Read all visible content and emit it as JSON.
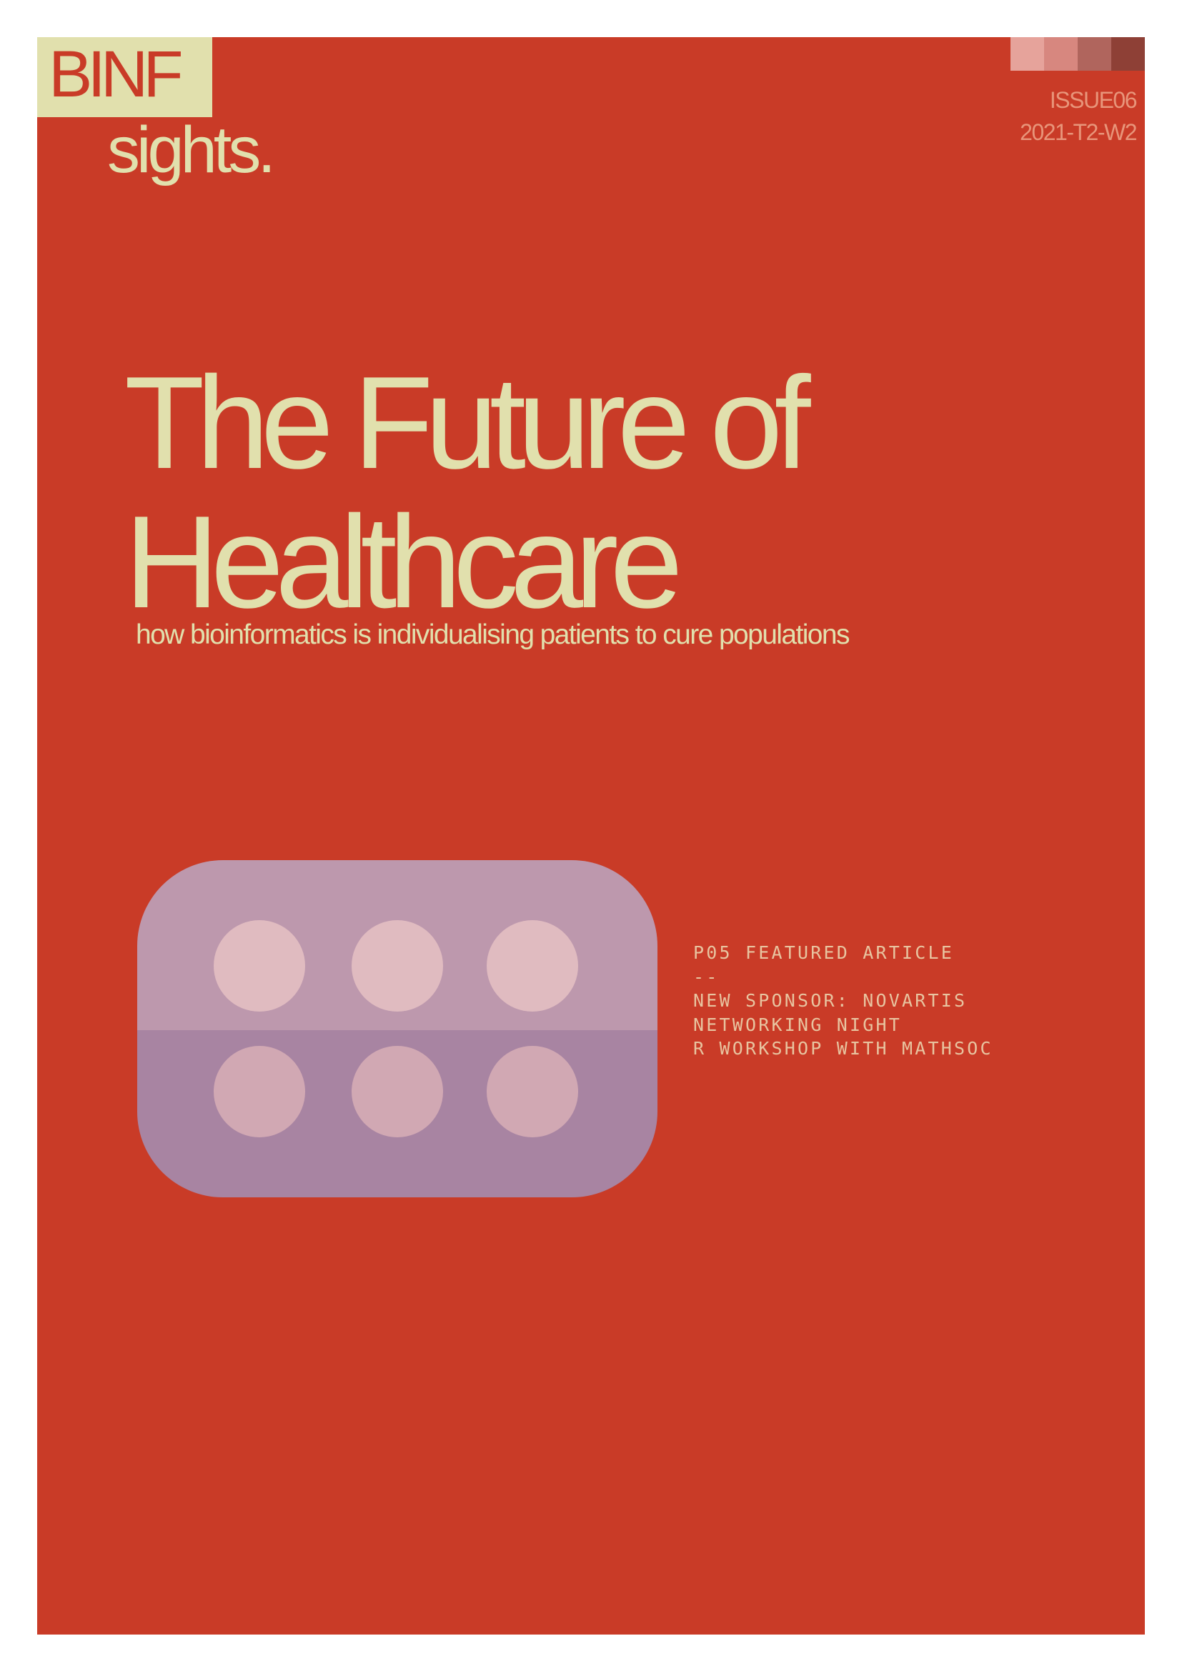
{
  "logo": {
    "primary": "BINF",
    "secondary": "sights."
  },
  "issue": {
    "number": "ISSUE06",
    "date": "2021-T2-W2"
  },
  "swatch_colors": [
    "#e6a39b",
    "#d7877f",
    "#b0655d",
    "#8e4036"
  ],
  "headline": {
    "line1": "The Future of",
    "line2": "Healthcare"
  },
  "subtitle": "how bioinformatics is individualising patients to cure populations",
  "illustration": {
    "icon": "pill-blister-pack-icon",
    "top_pill_color": "#e0bbc0",
    "bottom_pill_color": "#d1a8b3"
  },
  "contents": [
    "P05 FEATURED ARTICLE",
    "--",
    "NEW SPONSOR: NOVARTIS",
    "NETWORKING NIGHT",
    "R WORKSHOP WITH MATHSOC"
  ],
  "colors": {
    "background": "#c93b27",
    "accent": "#e1e0ad"
  }
}
